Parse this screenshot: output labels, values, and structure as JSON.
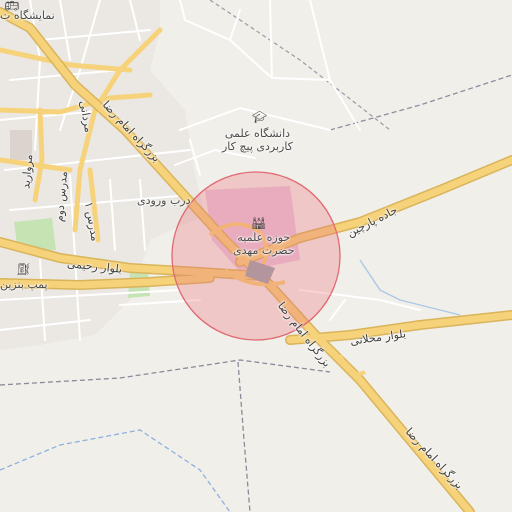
{
  "map": {
    "highlight_color": "#e8737b",
    "road_color": "#f6d27a",
    "campus_color": "#e8c8dd",
    "park_color": "#c6e3b4"
  },
  "places": {
    "hawza": {
      "line1": "حوزه علمیه",
      "line2": "حضرت مهدی",
      "icon": "religious-school-icon"
    },
    "university": {
      "line1": "دانشگاه علمی",
      "line2": "کاربردی پیچ کار",
      "icon": "graduation-cap-icon"
    },
    "gate": {
      "label": "درب ورودی"
    },
    "gas_station": {
      "label": "پمپ بنزین",
      "icon": "fuel-pump-icon"
    },
    "exhibition": {
      "label": "نمایشگاه ت",
      "icon": "bus-icon"
    }
  },
  "roads": {
    "imam_reza_north": "بزرگراه امام رضا",
    "imam_reza_center": "بزرگراه امام رضا",
    "imam_reza_south": "بزرگراه امام رضا",
    "parchin": "جاده پارچین",
    "mahallati": "بلوار محلاتی",
    "rahimi": "بلوار رحیمی",
    "mardani": "مردانی",
    "modarres1": "مدرس ۱",
    "modarres2": "مدرس دوم",
    "morvarid": "مروارید"
  }
}
